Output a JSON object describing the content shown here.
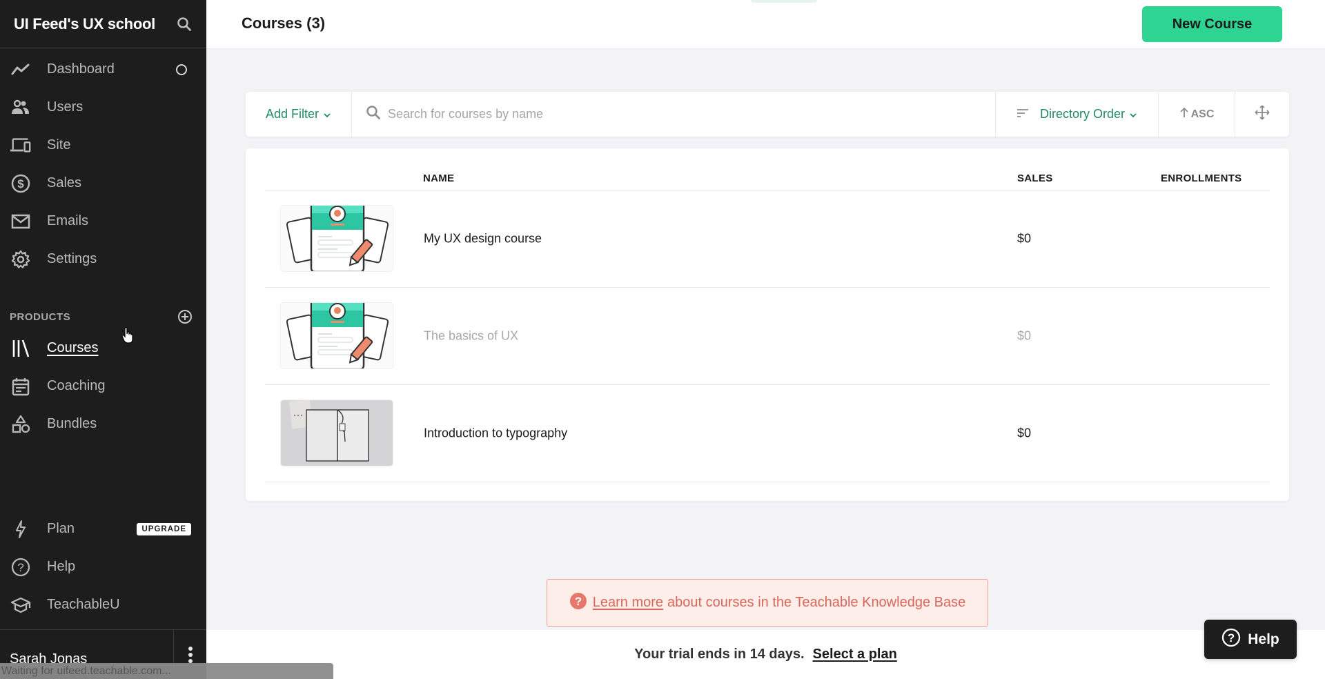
{
  "sidebar": {
    "school_name": "UI Feed's UX school",
    "nav": [
      {
        "label": "Dashboard",
        "icon": "trend-line-icon"
      },
      {
        "label": "Users",
        "icon": "users-icon"
      },
      {
        "label": "Site",
        "icon": "devices-icon"
      },
      {
        "label": "Sales",
        "icon": "dollar-circle-icon"
      },
      {
        "label": "Emails",
        "icon": "envelope-icon"
      },
      {
        "label": "Settings",
        "icon": "gear-icon"
      }
    ],
    "products_heading": "PRODUCTS",
    "products": [
      {
        "label": "Courses",
        "icon": "library-icon",
        "active": true
      },
      {
        "label": "Coaching",
        "icon": "calendar-icon"
      },
      {
        "label": "Bundles",
        "icon": "shapes-icon"
      }
    ],
    "bottom": [
      {
        "label": "Plan",
        "icon": "lightning-icon",
        "badge": "UPGRADE"
      },
      {
        "label": "Help",
        "icon": "question-circle-icon"
      },
      {
        "label": "TeachableU",
        "icon": "graduation-cap-icon"
      }
    ],
    "user_name": "Sarah Jonas"
  },
  "status_bar": "Waiting for uifeed.teachable.com...",
  "header": {
    "title": "Courses (3)",
    "new_course_label": "New Course"
  },
  "filters": {
    "add_filter_label": "Add Filter",
    "search_placeholder": "Search for courses by name",
    "search_value": "",
    "order_label": "Directory Order",
    "direction_label": "ASC"
  },
  "table": {
    "columns": [
      "NAME",
      "SALES",
      "ENROLLMENTS"
    ],
    "rows": [
      {
        "name": "My UX design course",
        "sales": "$0",
        "enrollments": "",
        "thumbnail": "illustration-profile-card",
        "published": true
      },
      {
        "name": "The basics of UX",
        "sales": "$0",
        "enrollments": "",
        "thumbnail": "illustration-profile-card",
        "published": false
      },
      {
        "name": "Introduction to typography",
        "sales": "$0",
        "enrollments": "",
        "thumbnail": "photo-open-notebook",
        "published": true
      }
    ]
  },
  "info_banner": {
    "link_text": "Learn more",
    "text": "about courses in the Teachable Knowledge Base"
  },
  "trial": {
    "message": "Your trial ends in 14 days.",
    "link_text": "Select a plan"
  },
  "help_button_label": "Help",
  "colors": {
    "sidebar_bg": "#1d1d1d",
    "accent_green": "#2ed592",
    "link_green": "#1f8a62",
    "info_red": "#d9665a",
    "page_bg": "#f3f3f6"
  }
}
